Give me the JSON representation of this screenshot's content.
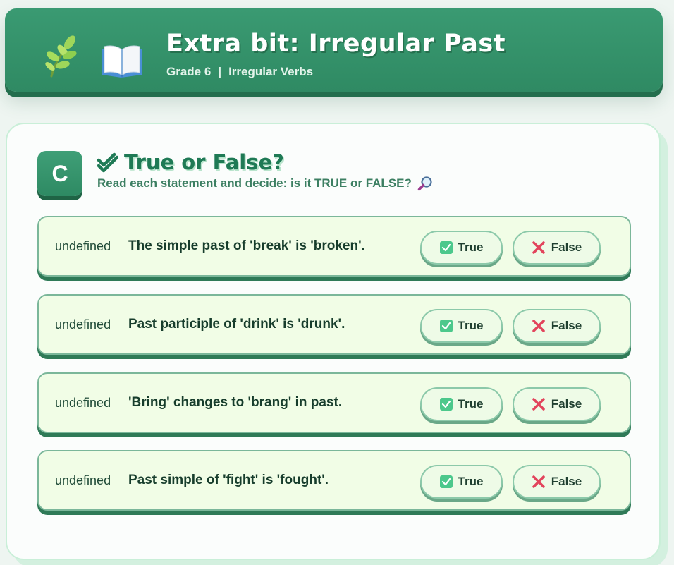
{
  "header": {
    "title": "Extra bit: Irregular Past",
    "grade": "Grade 6",
    "separator": "|",
    "topic": "Irregular Verbs",
    "icons": [
      "herb-icon",
      "open-book-icon"
    ]
  },
  "section": {
    "badge": "C",
    "title": "True or False?",
    "subtitle": "Read each statement and decide: is it TRUE or FALSE?",
    "icons": [
      "double-check-icon",
      "magnifier-icon"
    ]
  },
  "items": [
    {
      "num": "undefined",
      "text": "The simple past of 'break' is 'broken'.",
      "true_label": "True",
      "false_label": "False"
    },
    {
      "num": "undefined",
      "text": "Past participle of 'drink' is 'drunk'.",
      "true_label": "True",
      "false_label": "False"
    },
    {
      "num": "undefined",
      "text": "'Bring' changes to 'brang' in past.",
      "true_label": "True",
      "false_label": "False"
    },
    {
      "num": "undefined",
      "text": "Past simple of 'fight' is 'fought'.",
      "true_label": "True",
      "false_label": "False"
    }
  ],
  "colors": {
    "header_green": "#2f8a63",
    "title_green": "#1f7a55",
    "row_bg": "#f1fde6",
    "true_icon": "#4cc88c",
    "false_icon": "#e2445c"
  }
}
